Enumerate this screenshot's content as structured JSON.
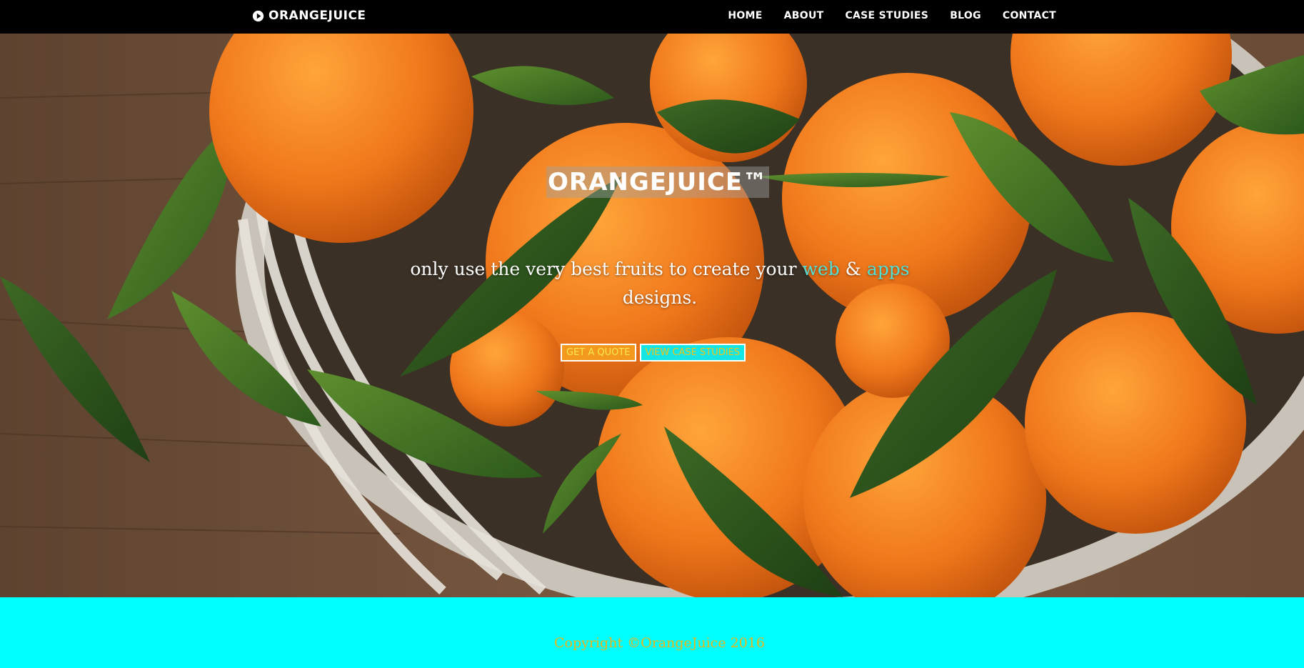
{
  "navbar": {
    "brand": "ORANGEJUICE",
    "brand_icon": "play-circle-icon",
    "links": [
      {
        "label": "HOME"
      },
      {
        "label": "ABOUT"
      },
      {
        "label": "CASE STUDIES"
      },
      {
        "label": "BLOG"
      },
      {
        "label": "CONTACT"
      }
    ]
  },
  "hero": {
    "title": "ORANGEJUICE™",
    "tagline_before": "only use the very best fruits to create your ",
    "tagline_web": "web",
    "tagline_amp": " & ",
    "tagline_apps": "apps",
    "tagline_after": " designs.",
    "background_image": "oranges-in-wicker-basket-with-leaves",
    "buttons": {
      "quote": "GET A QUOTE",
      "cases": "VIEW CASE STUDIES"
    }
  },
  "footer": {
    "copyright": "Copyright ©OrangeJuice 2016"
  },
  "colors": {
    "navbar_bg": "#000000",
    "footer_bg": "#00ffff",
    "accent_teal": "#52e0d6",
    "button_quote_bg": "#f39a1e",
    "button_cases_bg": "#14e6e6",
    "copyright_text": "#e7b41a"
  }
}
